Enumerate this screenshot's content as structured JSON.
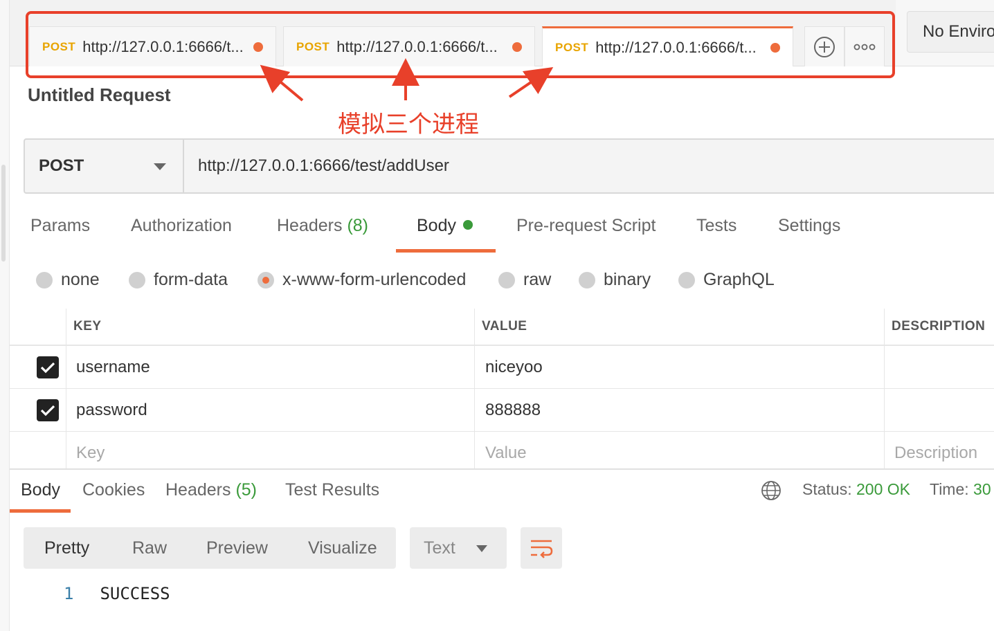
{
  "tabs": [
    {
      "method": "POST",
      "url": "http://127.0.0.1:6666/t...",
      "active": false
    },
    {
      "method": "POST",
      "url": "http://127.0.0.1:6666/t...",
      "active": false
    },
    {
      "method": "POST",
      "url": "http://127.0.0.1:6666/t...",
      "active": true
    }
  ],
  "tab_actions": {
    "add_icon": "plus-circle-icon",
    "more_icon": "more-horizontal-icon"
  },
  "environment": {
    "label": "No Enviro"
  },
  "annotation": {
    "text": "模拟三个进程",
    "color": "#e8402a"
  },
  "request": {
    "title": "Untitled Request",
    "method": "POST",
    "url": "http://127.0.0.1:6666/test/addUser"
  },
  "request_tabs": {
    "params": "Params",
    "authorization": "Authorization",
    "headers": "Headers",
    "headers_count": "(8)",
    "body": "Body",
    "pre_request": "Pre-request Script",
    "tests": "Tests",
    "settings": "Settings"
  },
  "body_types": {
    "none": "none",
    "form_data": "form-data",
    "urlencoded": "x-www-form-urlencoded",
    "raw": "raw",
    "binary": "binary",
    "graphql": "GraphQL",
    "selected": "x-www-form-urlencoded"
  },
  "kv_table": {
    "headers": {
      "key": "KEY",
      "value": "VALUE",
      "description": "DESCRIPTION"
    },
    "rows": [
      {
        "checked": true,
        "key": "username",
        "value": "niceyoo",
        "description": ""
      },
      {
        "checked": true,
        "key": "password",
        "value": "888888",
        "description": ""
      }
    ],
    "placeholder": {
      "key": "Key",
      "value": "Value",
      "description": "Description"
    }
  },
  "response": {
    "tabs": {
      "body": "Body",
      "cookies": "Cookies",
      "headers": "Headers",
      "headers_count": "(5)",
      "test_results": "Test Results"
    },
    "status_label": "Status:",
    "status_value": "200 OK",
    "time_label": "Time:",
    "time_value": "30",
    "views": {
      "pretty": "Pretty",
      "raw": "Raw",
      "preview": "Preview",
      "visualize": "Visualize"
    },
    "format": "Text",
    "wrap_icon": "wrap-lines-icon",
    "globe_icon": "globe-icon",
    "lines": [
      {
        "num": "1",
        "text": "SUCCESS"
      }
    ]
  },
  "colors": {
    "accent": "#ee6c3c",
    "method_post": "#e8a400",
    "success": "#3a9a3a",
    "annotation": "#e8402a"
  }
}
